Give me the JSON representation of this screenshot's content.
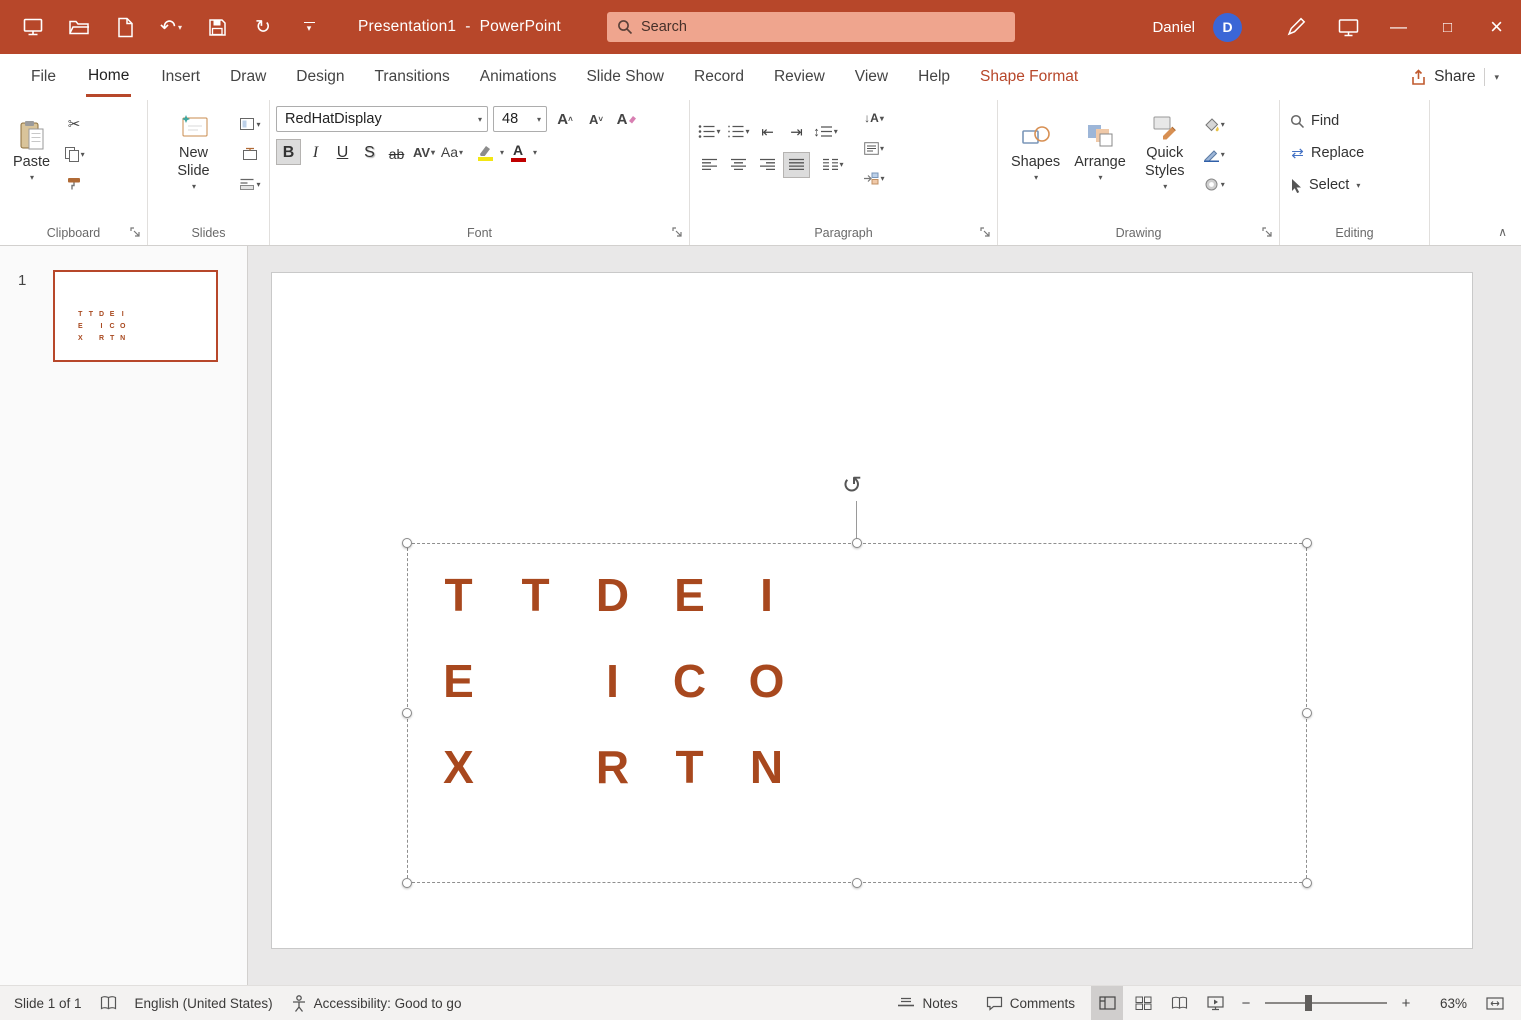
{
  "colors": {
    "accent": "#b7472a",
    "accent_light": "#efa58e",
    "slide_text": "#a8481e",
    "avatar": "#3b66d6"
  },
  "titlebar": {
    "title": "Presentation1  -  PowerPoint",
    "search_placeholder": "Search",
    "user": "Daniel",
    "avatar": "D"
  },
  "tabs": [
    {
      "label": "File"
    },
    {
      "label": "Home"
    },
    {
      "label": "Insert"
    },
    {
      "label": "Draw"
    },
    {
      "label": "Design"
    },
    {
      "label": "Transitions"
    },
    {
      "label": "Animations"
    },
    {
      "label": "Slide Show"
    },
    {
      "label": "Record"
    },
    {
      "label": "Review"
    },
    {
      "label": "View"
    },
    {
      "label": "Help"
    },
    {
      "label": "Shape Format"
    }
  ],
  "share": {
    "label": "Share"
  },
  "ribbon": {
    "clipboard": {
      "group_label": "Clipboard",
      "paste_label": "Paste"
    },
    "slides": {
      "group_label": "Slides",
      "new_slide_label": "New Slide"
    },
    "font": {
      "group_label": "Font",
      "family": "RedHatDisplay",
      "size": "48",
      "bold": "B",
      "italic": "I",
      "underline": "U",
      "shadow": "S",
      "strikethrough": "ab",
      "spacing": "AV",
      "case": "Aa",
      "color_letter": "A"
    },
    "paragraph": {
      "group_label": "Paragraph"
    },
    "drawing": {
      "group_label": "Drawing",
      "shapes": "Shapes",
      "arrange": "Arrange",
      "quick_styles": "Quick Styles"
    },
    "editing": {
      "group_label": "Editing",
      "find": "Find",
      "replace": "Replace",
      "select": "Select"
    }
  },
  "slides_panel": {
    "slide_number": "1"
  },
  "slide": {
    "textbox_rows": [
      [
        "T",
        "T",
        "D",
        "E",
        "I"
      ],
      [
        "E",
        "",
        "I",
        "C",
        "O"
      ],
      [
        "X",
        "",
        "R",
        "T",
        "N"
      ]
    ]
  },
  "statusbar": {
    "slide_info": "Slide 1 of 1",
    "language": "English (United States)",
    "accessibility": "Accessibility: Good to go",
    "notes": "Notes",
    "comments": "Comments",
    "zoom": "63%"
  },
  "glyphs": {
    "chevron_down": "▾",
    "chevron_up": "∧",
    "scissors": "✂",
    "undo": "↶",
    "redo": "↻",
    "rotate": "↻",
    "minimize": "—",
    "maximize": "□",
    "close": "×",
    "indent_dec": "⇤",
    "indent_inc": "⇥",
    "updown": "↕",
    "arrow_down": "↓",
    "swap": "⇄",
    "letter_A": "A",
    "minus": "−",
    "plus": "+"
  }
}
